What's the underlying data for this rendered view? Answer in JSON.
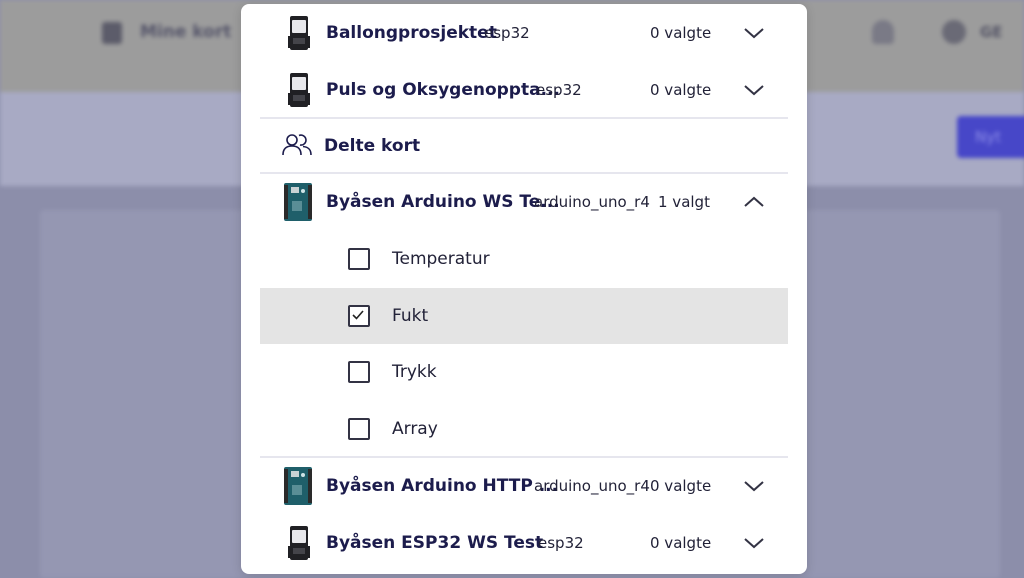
{
  "background": {
    "title": "Mine kort",
    "user": "GE",
    "button_label": "Nyt"
  },
  "dropdown": {
    "boards_top": [
      {
        "name": "Ballongprosjektet",
        "type": "esp32",
        "count": "0 valgte",
        "icon": "esp32-board-icon",
        "expanded": false
      },
      {
        "name": "Puls og Oksygenoppta...",
        "type": "esp32",
        "count": "0 valgte",
        "icon": "esp32-board-icon",
        "expanded": false
      }
    ],
    "shared_section": {
      "label": "Delte kort",
      "icon": "users-icon"
    },
    "expanded_board": {
      "name": "Byåsen Arduino WS Te...",
      "type": "arduino_uno_r4",
      "count": "1 valgt",
      "icon": "arduino-board-icon",
      "expanded": true,
      "sensors": [
        {
          "label": "Temperatur",
          "checked": false
        },
        {
          "label": "Fukt",
          "checked": true
        },
        {
          "label": "Trykk",
          "checked": false
        },
        {
          "label": "Array",
          "checked": false
        }
      ]
    },
    "boards_bottom": [
      {
        "name": "Byåsen Arduino HTTP ...",
        "type": "arduino_uno_r4",
        "count": "0 valgte",
        "icon": "arduino-board-icon",
        "expanded": false
      },
      {
        "name": "Byåsen ESP32 WS Test",
        "type": "esp32",
        "count": "0 valgte",
        "icon": "esp32-board-icon",
        "expanded": false
      }
    ]
  },
  "colors": {
    "accent": "#1c1c4c",
    "selected_row": "#e4e4e4",
    "overlay": "#8d8fab",
    "arduino_teal": "#1f5f6a"
  }
}
